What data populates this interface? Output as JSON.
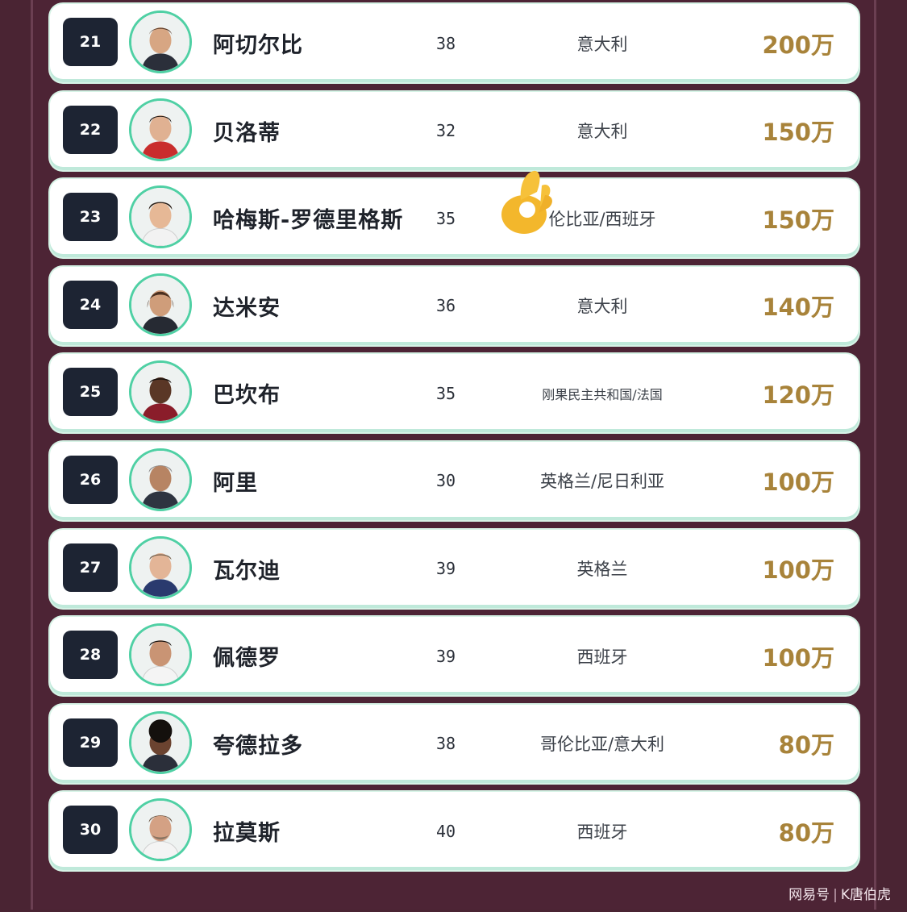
{
  "rows": [
    {
      "rank": "21",
      "name": "阿切尔比",
      "age": "38",
      "nation": "意大利",
      "value": "200万",
      "avatar_icon": "player-portrait-icon"
    },
    {
      "rank": "22",
      "name": "贝洛蒂",
      "age": "32",
      "nation": "意大利",
      "value": "150万",
      "avatar_icon": "player-portrait-icon"
    },
    {
      "rank": "23",
      "name": "哈梅斯-罗德里格斯",
      "age": "35",
      "nation": "伦比亚/西班牙",
      "value": "150万",
      "avatar_icon": "player-portrait-icon"
    },
    {
      "rank": "24",
      "name": "达米安",
      "age": "36",
      "nation": "意大利",
      "value": "140万",
      "avatar_icon": "player-portrait-icon"
    },
    {
      "rank": "25",
      "name": "巴坎布",
      "age": "35",
      "nation": "刚果民主共和国/法国",
      "value": "120万",
      "avatar_icon": "player-portrait-icon"
    },
    {
      "rank": "26",
      "name": "阿里",
      "age": "30",
      "nation": "英格兰/尼日利亚",
      "value": "100万",
      "avatar_icon": "player-portrait-icon"
    },
    {
      "rank": "27",
      "name": "瓦尔迪",
      "age": "39",
      "nation": "英格兰",
      "value": "100万",
      "avatar_icon": "player-portrait-icon"
    },
    {
      "rank": "28",
      "name": "佩德罗",
      "age": "39",
      "nation": "西班牙",
      "value": "100万",
      "avatar_icon": "player-portrait-icon"
    },
    {
      "rank": "29",
      "name": "夸德拉多",
      "age": "38",
      "nation": "哥伦比亚/意大利",
      "value": "80万",
      "avatar_icon": "player-portrait-icon"
    },
    {
      "rank": "30",
      "name": "拉莫斯",
      "age": "40",
      "nation": "西班牙",
      "value": "80万",
      "avatar_icon": "player-portrait-icon"
    }
  ],
  "overlay": {
    "emoji_icon": "ok-hand-emoji-icon"
  },
  "watermark": {
    "platform": "网易号",
    "author": "K唐伯虎"
  },
  "colors": {
    "background": "#4a2433",
    "rank_badge": "#1d2433",
    "avatar_ring": "#4fd0a4",
    "value_text": "#a8833a",
    "card": "#ffffff"
  }
}
